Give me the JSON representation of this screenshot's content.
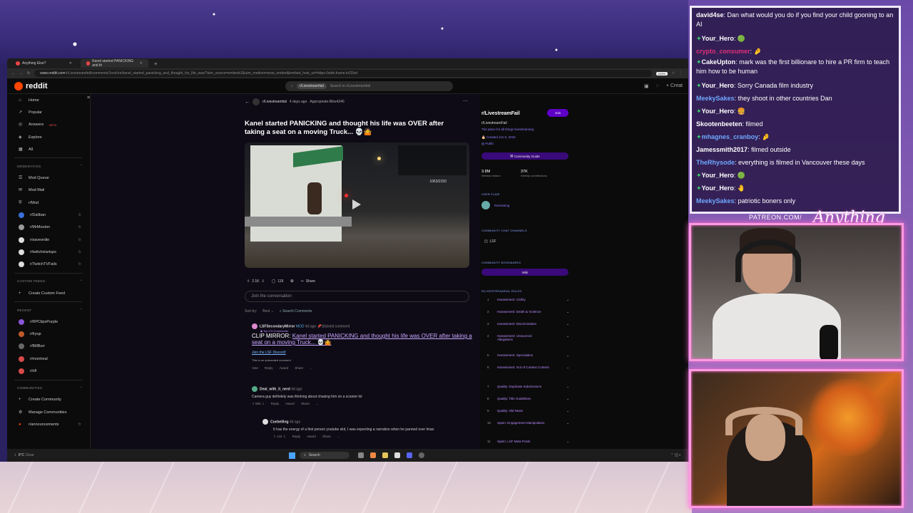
{
  "browser": {
    "tabs": [
      {
        "label": "Anything Else?"
      },
      {
        "label": "Kanel started PANICKING and th"
      }
    ],
    "url_host": "www.reddit.com",
    "url_path": "/r/Livestreamfail/comments/1nxd-kn/kanel_started_panicking_and_thought_his_life_was/?utm_source=embedv2&utm_medium=post_embed&embed_host_url=https://stdn.frame.tv/33xd",
    "zoom": "110%"
  },
  "reddit": {
    "logo": "reddit",
    "search_chip": "r/Livestreamfail",
    "search_placeholder": "Search in r/Livestreamfail",
    "create_label": "Creat"
  },
  "sidebar": {
    "nav": [
      {
        "label": "Home",
        "icon": "home-icon",
        "glyph": "⌂"
      },
      {
        "label": "Popular",
        "icon": "popular-icon",
        "glyph": "↗"
      },
      {
        "label": "Answers",
        "badge": "BETA",
        "icon": "answers-icon",
        "glyph": "◎"
      },
      {
        "label": "Explore",
        "icon": "explore-icon",
        "glyph": "◈"
      },
      {
        "label": "All",
        "icon": "all-icon",
        "glyph": "▦"
      }
    ],
    "moderation_heading": "MODERATION",
    "moderation": [
      {
        "label": "Mod Queue",
        "glyph": "☰"
      },
      {
        "label": "Mod Mail",
        "glyph": "✉"
      },
      {
        "label": "r/Mod",
        "glyph": "⛨"
      }
    ],
    "communities_mod": [
      {
        "label": "r/Daliban",
        "color": "#3a6fd8"
      },
      {
        "label": "r/MrMouton",
        "color": "#999"
      },
      {
        "label": "r/saveordie",
        "color": "#ddd"
      },
      {
        "label": "r/twitchstartups",
        "color": "#ddd"
      },
      {
        "label": "r/TwitchTVFails",
        "color": "#ddd"
      }
    ],
    "custom_heading": "CUSTOM FEEDS",
    "custom_create": "Create Custom Feed",
    "recent_heading": "RECENT",
    "recent": [
      {
        "label": "r/RPClipsPurple",
        "color": "#8a55d8"
      },
      {
        "label": "r/fryup",
        "color": "#c05a2a"
      },
      {
        "label": "r/BillBurr",
        "color": "#666"
      },
      {
        "label": "r/montreal",
        "color": "#d84a4a"
      },
      {
        "label": "r/nfl",
        "color": "#d84a4a"
      }
    ],
    "communities_heading": "COMMUNITIES",
    "communities": [
      {
        "label": "Create Community",
        "glyph": "+"
      },
      {
        "label": "Manage Communities",
        "glyph": "⚙"
      },
      {
        "label": "r/announcements",
        "glyph": "●"
      }
    ]
  },
  "post": {
    "subreddit": "r/Livestreamfail",
    "time": "4 days ago",
    "author": "Appropriate-Bike4246",
    "title": "Kanel started PANICKING and thought his life was OVER after taking a seat on a moving Truck... 💀🤷",
    "video_counter": "1063/2150",
    "votes": "2.1K",
    "comments": "119",
    "share_label": "Share",
    "join_placeholder": "Join the conversation",
    "sort_label": "Sort by:",
    "sort_value": "Best",
    "search_comments": "Search Comments"
  },
  "comments": [
    {
      "author": "LSFSecondaryMirror",
      "flair": "MOD",
      "time": "4d ago",
      "pinned": "Stickied comment",
      "badge": "Top 1% Commenter",
      "clip_prefix": "CLIP MIRROR: ",
      "clip_link": "Kanel started PANICKING and thought his life was OVER after taking a seat on a moving Truck... 💀🤷",
      "discord": "Join the LSF Discord!",
      "note": "This is an automated comment",
      "actions": [
        "Vote",
        "Reply",
        "Award",
        "Share",
        "..."
      ]
    },
    {
      "author": "Deal_with_it_nerd",
      "time": "4d ago",
      "text": "Camera guy definitely was thinking about chasing him on a scooter lol",
      "votes": "655",
      "actions": [
        "Reply",
        "Award",
        "Share",
        "..."
      ]
    },
    {
      "author": "Cuebelling",
      "time": "4d ago",
      "text": "It has the energy of a first person youtube skit, I was expecting a narration when he panned over lmao",
      "votes": "144",
      "actions": [
        "Reply",
        "Award",
        "Share",
        "..."
      ]
    }
  ],
  "rail": {
    "title": "r/LivestreamFail",
    "join": "Join",
    "name": "r/LivestreamFail",
    "tagline": "The place for all things livestreaming.",
    "created": "Created Jun 5, 2015",
    "visibility": "Public",
    "guide": "Community Guide",
    "members": "3.8M",
    "members_label": "Weekly visitors",
    "contributions": "37K",
    "contributions_label": "Weekly contributions",
    "flair_heading": "USER FLAIR",
    "flair_name": "Remiseing",
    "chat_heading": "COMMUNITY CHAT CHANNELS",
    "chat_channel": "LSF",
    "bookmarks_heading": "COMMUNITY BOOKMARKS",
    "wiki": "Wiki",
    "rules_heading": "R/LIVESTREAMFAIL RULES",
    "rules": [
      {
        "n": "1",
        "label": "Harassment: Civility"
      },
      {
        "n": "2",
        "label": "Harassment: Death & Violence"
      },
      {
        "n": "3",
        "label": "Harassment: Discrimination"
      },
      {
        "n": "4",
        "label": "Harassment: Unsourced Allegations"
      },
      {
        "n": "5",
        "label": "Harassment: Speculation"
      },
      {
        "n": "6",
        "label": "Harassment: Out of Context Content"
      },
      {
        "n": "7",
        "label": "Quality: Duplicate Submissions"
      },
      {
        "n": "8",
        "label": "Quality: Title Guidelines"
      },
      {
        "n": "9",
        "label": "Quality: Old News"
      },
      {
        "n": "10",
        "label": "Spam: Engagement Manipulation"
      },
      {
        "n": "11",
        "label": "Spam: LSF Meta Posts"
      }
    ]
  },
  "taskbar": {
    "weather_temp": "8°C",
    "weather_desc": "Clear",
    "search": "Search"
  },
  "chat": [
    {
      "user": "david4se",
      "color": "#ffffff",
      "text": "Dan what would you do if you find your child gooning to an AI",
      "gem": false
    },
    {
      "user": "Your_Hero",
      "color": "#ffffff",
      "text": "🟢",
      "gem": true
    },
    {
      "user": "crypto_consumer",
      "color": "#e0307a",
      "text": "🤌",
      "gem": false
    },
    {
      "user": "CakeUpton",
      "color": "#ffffff",
      "text": "mark was the first billionare to hire a PR firm to teach him how to be human",
      "gem": true
    },
    {
      "user": "Your_Hero",
      "color": "#ffffff",
      "text": "Sorry Canada film industry",
      "gem": true
    },
    {
      "user": "MeekySakes",
      "color": "#6fa8ff",
      "text": "they shoot in other countries Dan",
      "gem": false
    },
    {
      "user": "Your_Hero",
      "color": "#ffffff",
      "text": "🍔",
      "gem": true
    },
    {
      "user": "Skootenbeeten",
      "color": "#ffffff",
      "text": "filmed",
      "gem": false
    },
    {
      "user": "mhagnes_cranboy",
      "color": "#6fa8ff",
      "text": "🤌",
      "gem": true
    },
    {
      "user": "Jamessmith2017",
      "color": "#ffffff",
      "text": "filmed outside",
      "gem": false
    },
    {
      "user": "TheRhysode",
      "color": "#6fa8ff",
      "text": "everything is filmed in Vancouver these days",
      "gem": false
    },
    {
      "user": "Your_Hero",
      "color": "#ffffff",
      "text": "🟢",
      "gem": true
    },
    {
      "user": "Your_Hero",
      "color": "#ffffff",
      "text": "🤚",
      "gem": true
    },
    {
      "user": "MeekySakes",
      "color": "#6fa8ff",
      "text": "patriotic boners only",
      "gem": false
    }
  ],
  "overlay": {
    "patreon": "PATREON.COM/",
    "brand": "Anything Else?"
  }
}
